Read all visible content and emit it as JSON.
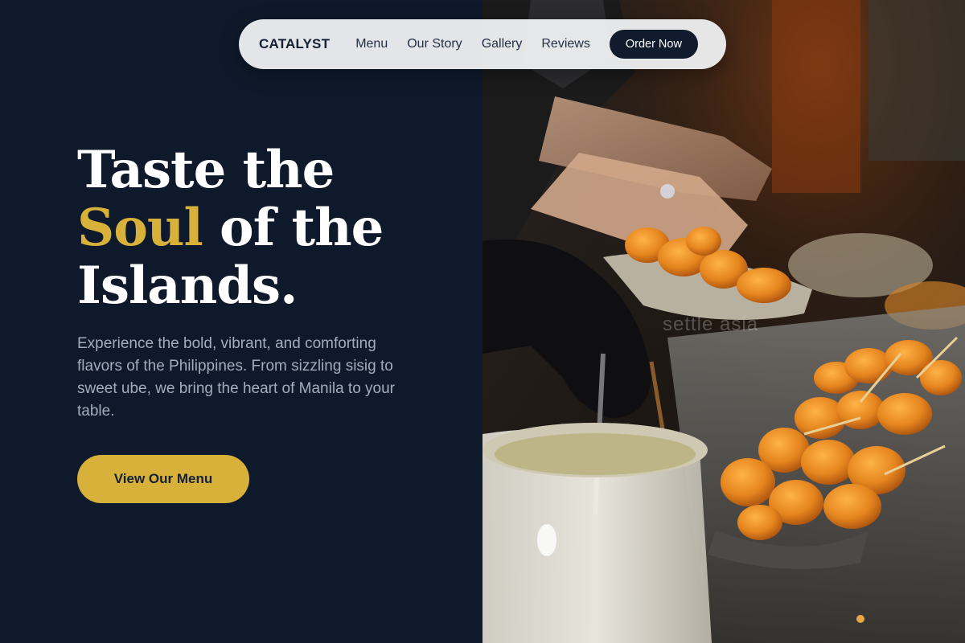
{
  "nav": {
    "brand": "CATALYST",
    "links": [
      {
        "label": "Menu"
      },
      {
        "label": "Our Story"
      },
      {
        "label": "Gallery"
      },
      {
        "label": "Reviews"
      }
    ],
    "cta_label": "Order Now"
  },
  "hero": {
    "title_line1": "Taste the",
    "title_accent": "Soul",
    "title_line2_rest": " of the",
    "title_line3": "Islands.",
    "subtitle": "Experience the bold, vibrant, and comforting flavors of the Philippines. From sizzling sisig to sweet ube, we bring the heart of Manila to your table.",
    "cta_label": "View Our Menu"
  },
  "image": {
    "subject": "street food vendor serving fried skewers",
    "watermark": "settle asia"
  },
  "colors": {
    "background": "#0e1a2b",
    "accent": "#d8b13b",
    "nav_bg": "#f4f5f7",
    "text_primary": "#ffffff",
    "text_muted": "#a3acbb"
  }
}
